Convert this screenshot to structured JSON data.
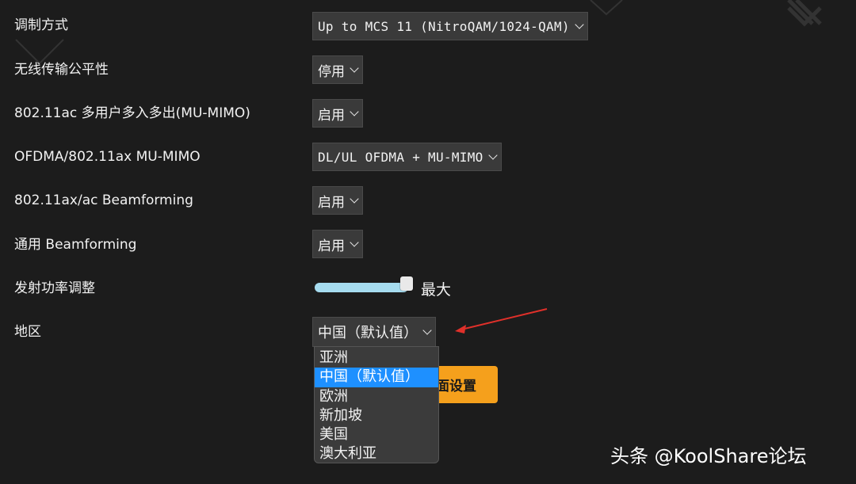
{
  "rows": [
    {
      "label": "调制方式",
      "value": "Up to MCS 11 (NitroQAM/1024-QAM)"
    },
    {
      "label": "无线传输公平性",
      "value": "停用"
    },
    {
      "label": "802.11ac 多用户多入多出(MU-MIMO)",
      "value": "启用"
    },
    {
      "label": "OFDMA/802.11ax MU-MIMO",
      "value": "DL/UL OFDMA + MU-MIMO"
    },
    {
      "label": "802.11ax/ac Beamforming",
      "value": "启用"
    },
    {
      "label": "通用 Beamforming",
      "value": "启用"
    },
    {
      "label": "发射功率调整",
      "value": "最大"
    },
    {
      "label": "地区",
      "value": "中国（默认值）"
    }
  ],
  "transmit_power": {
    "level": 1.0
  },
  "region_dropdown": {
    "options": [
      "亚洲",
      "中国（默认值）",
      "欧洲",
      "新加坡",
      "美国",
      "澳大利亚"
    ],
    "selected_index": 1
  },
  "apply_button": {
    "label": "面设置"
  },
  "watermark": {
    "text": "头条 @KoolShare论坛",
    "logo_text": "KoolShare"
  },
  "colors": {
    "accent": "#f5a01c",
    "selection": "#1e90ff",
    "slider": "#a6dcef",
    "arrow": "#e0302a"
  }
}
